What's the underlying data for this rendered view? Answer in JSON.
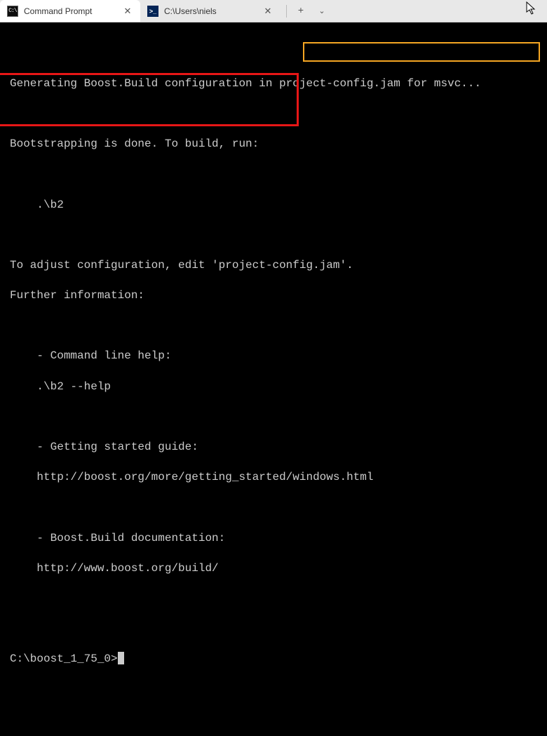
{
  "tabs": {
    "active": {
      "label": "Command Prompt"
    },
    "inactive": {
      "label": "C:\\Users\\niels"
    }
  },
  "terminal": {
    "line_config_prefix": "Generating Boost.Build configuration in ",
    "line_config_target": "project-config.jam for msvc...",
    "line_bootstrap": "Bootstrapping is done. To build, run:",
    "line_b2": "    .\\b2",
    "line_adjust": "To adjust configuration, edit 'project-config.jam'.",
    "line_further": "Further information:",
    "line_cmd_help": "    - Command line help:",
    "line_b2_help": "    .\\b2 --help",
    "line_guide": "    - Getting started guide:",
    "line_guide_url": "    http://boost.org/more/getting_started/windows.html",
    "line_docs": "    - Boost.Build documentation:",
    "line_docs_url": "    http://www.boost.org/build/",
    "prompt": "C:\\boost_1_75_0>"
  }
}
